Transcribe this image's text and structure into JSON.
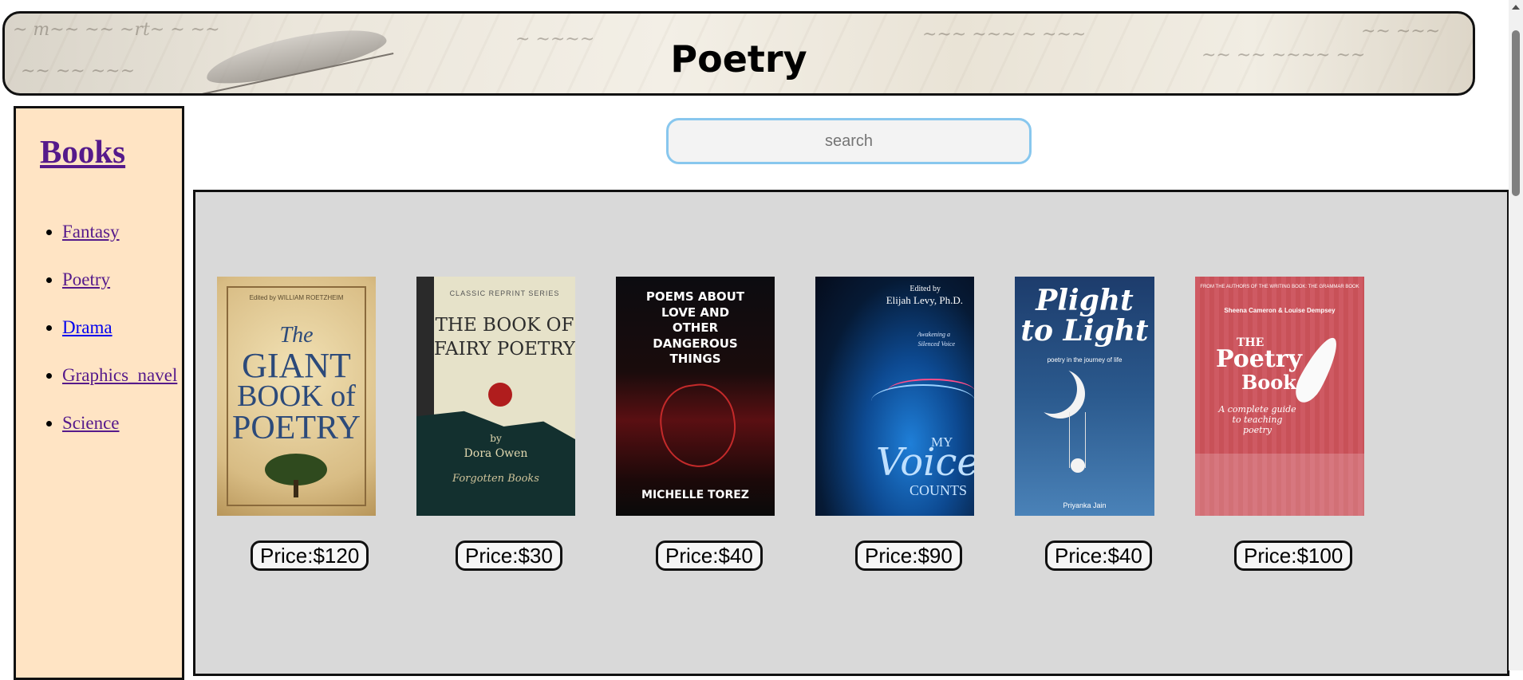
{
  "header": {
    "title": "Poetry"
  },
  "sidebar": {
    "heading": "Books",
    "items": [
      {
        "label": "Fantasy"
      },
      {
        "label": "Poetry"
      },
      {
        "label": "Drama"
      },
      {
        "label": "Graphics_navel"
      },
      {
        "label": "Science"
      }
    ]
  },
  "search": {
    "placeholder": "search",
    "value": ""
  },
  "products": [
    {
      "price": "Price:$120",
      "cover": {
        "editor": "Edited by WILLIAM ROETZHEIM",
        "line1": "The",
        "line2": "GIANT",
        "line3": "BOOK of",
        "line4": "POETRY"
      }
    },
    {
      "price": "Price:$30",
      "cover": {
        "series": "CLASSIC REPRINT SERIES",
        "line1": "THE BOOK OF",
        "line2": "FAIRY POETRY",
        "by": "by",
        "author": "Dora Owen",
        "publisher": "Forgotten Books"
      }
    },
    {
      "price": "Price:$40",
      "cover": {
        "line1": "POEMS ABOUT",
        "line2": "LOVE AND",
        "line3": "OTHER",
        "line4": "DANGEROUS",
        "line5": "THINGS",
        "author": "MICHELLE TOREZ"
      }
    },
    {
      "price": "Price:$90",
      "cover": {
        "editor": "Edited by",
        "name": "Elijah Levy, Ph.D.",
        "sub1": "Awakening a",
        "sub2": "Silenced Voice",
        "my": "MY",
        "voice": "Voice",
        "counts": "COUNTS"
      }
    },
    {
      "price": "Price:$40",
      "cover": {
        "line1": "Plight",
        "line2": "to Light",
        "tag": "poetry in the journey of life",
        "author": "Priyanka Jain"
      }
    },
    {
      "price": "Price:$100",
      "cover": {
        "top": "FROM THE AUTHORS OF THE WRITING BOOK: THE GRAMMAR BOOK",
        "authors": "Sheena Cameron & Louise Dempsey",
        "the": "THE",
        "poetry": "Poetry",
        "book": "Book",
        "sub": "A complete guide to teaching poetry"
      }
    }
  ]
}
